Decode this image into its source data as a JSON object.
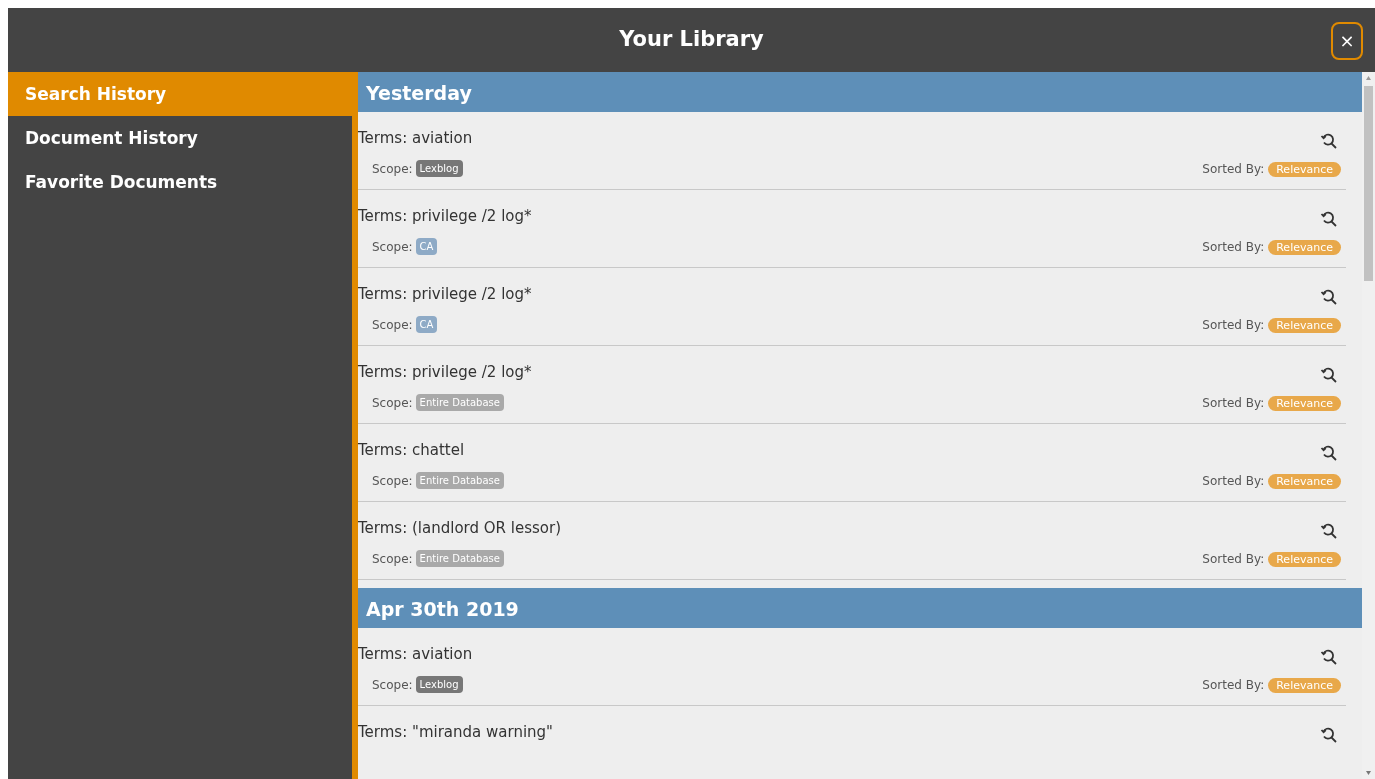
{
  "window": {
    "title": "Your Library",
    "close": "×"
  },
  "sidebar": {
    "items": [
      {
        "label": "Search History",
        "selected": true
      },
      {
        "label": "Document History",
        "selected": false
      },
      {
        "label": "Favorite Documents",
        "selected": false
      }
    ]
  },
  "groups": [
    {
      "heading": "Yesterday",
      "entries": [
        {
          "terms": "Terms: aviation",
          "scope_label": "Scope:",
          "scope": "Lexblog",
          "color": "#777777",
          "sort_label": "Sorted By:",
          "sort": "Relevance"
        },
        {
          "terms": "Terms: privilege /2 log*",
          "scope_label": "Scope:",
          "scope": "CA",
          "color": "#8eaac6",
          "sort_label": "Sorted By:",
          "sort": "Relevance"
        },
        {
          "terms": "Terms: privilege /2 log*",
          "scope_label": "Scope:",
          "scope": "CA",
          "color": "#8eaac6",
          "sort_label": "Sorted By:",
          "sort": "Relevance"
        },
        {
          "terms": "Terms: privilege /2 log*",
          "scope_label": "Scope:",
          "scope": "Entire Database",
          "color": "#a9a9a9",
          "sort_label": "Sorted By:",
          "sort": "Relevance"
        },
        {
          "terms": "Terms: chattel",
          "scope_label": "Scope:",
          "scope": "Entire Database",
          "color": "#a9a9a9",
          "sort_label": "Sorted By:",
          "sort": "Relevance"
        },
        {
          "terms": "Terms: (landlord OR lessor)",
          "scope_label": "Scope:",
          "scope": "Entire Database",
          "color": "#a9a9a9",
          "sort_label": "Sorted By:",
          "sort": "Relevance"
        }
      ]
    },
    {
      "heading": "Apr 30th 2019",
      "entries": [
        {
          "terms": "Terms: aviation",
          "scope_label": "Scope:",
          "scope": "Lexblog",
          "color": "#777777",
          "sort_label": "Sorted By:",
          "sort": "Relevance"
        },
        {
          "terms": "Terms: \"miranda warning\""
        }
      ]
    }
  ]
}
